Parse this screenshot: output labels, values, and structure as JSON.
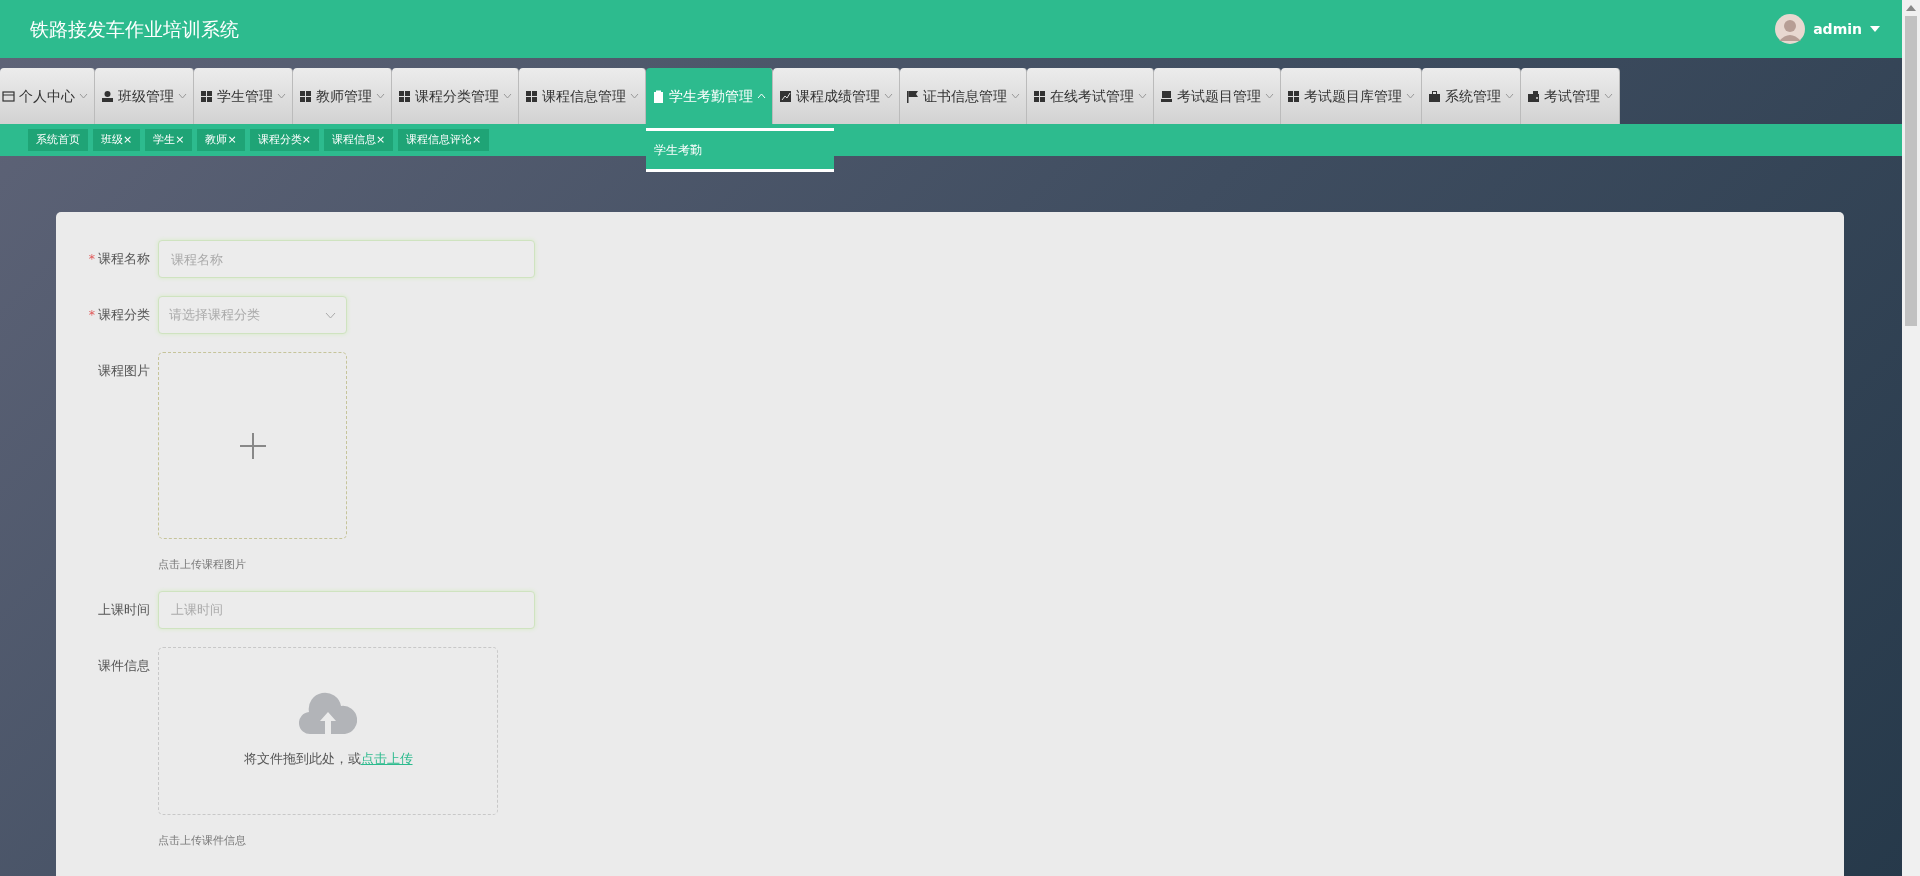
{
  "header": {
    "title": "铁路接发车作业培训系统",
    "user": {
      "name": "admin"
    }
  },
  "nav": [
    {
      "label": "个人中心",
      "selected": false,
      "expanded": false
    },
    {
      "label": "班级管理",
      "selected": false,
      "expanded": false
    },
    {
      "label": "学生管理",
      "selected": false,
      "expanded": false
    },
    {
      "label": "教师管理",
      "selected": false,
      "expanded": false
    },
    {
      "label": "课程分类管理",
      "selected": false,
      "expanded": false
    },
    {
      "label": "课程信息管理",
      "selected": false,
      "expanded": false
    },
    {
      "label": "学生考勤管理",
      "selected": true,
      "expanded": true,
      "children": [
        {
          "label": "学生考勤"
        }
      ]
    },
    {
      "label": "课程成绩管理",
      "selected": false,
      "expanded": false
    },
    {
      "label": "证书信息管理",
      "selected": false,
      "expanded": false
    },
    {
      "label": "在线考试管理",
      "selected": false,
      "expanded": false
    },
    {
      "label": "考试题目管理",
      "selected": false,
      "expanded": false
    },
    {
      "label": "考试题目库管理",
      "selected": false,
      "expanded": false
    },
    {
      "label": "系统管理",
      "selected": false,
      "expanded": false
    },
    {
      "label": "考试管理",
      "selected": false,
      "expanded": false
    }
  ],
  "tags": [
    {
      "label": "系统首页"
    },
    {
      "label": "班级",
      "close": "×"
    },
    {
      "label": "学生",
      "close": "×"
    },
    {
      "label": "教师",
      "close": "×"
    },
    {
      "label": "课程分类",
      "close": "×"
    },
    {
      "label": "课程信息",
      "close": "×"
    },
    {
      "label": "课程信息评论",
      "close": "×"
    }
  ],
  "form": [
    {
      "kind": "text",
      "label": "课程名称",
      "required_mark": "*",
      "placeholder": "课程名称"
    },
    {
      "kind": "select",
      "label": "课程分类",
      "required_mark": "*",
      "placeholder": "请选择课程分类"
    },
    {
      "kind": "image",
      "label": "课程图片",
      "hint": "点击上传课程图片"
    },
    {
      "kind": "text",
      "label": "上课时间",
      "placeholder": "上课时间"
    },
    {
      "kind": "file",
      "label": "课件信息",
      "drop_text": "将文件拖到此处，或",
      "drop_link": "点击上传",
      "hint": "点击上传课件信息"
    }
  ]
}
